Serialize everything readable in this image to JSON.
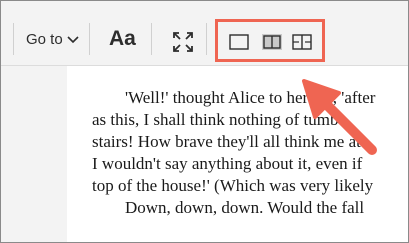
{
  "toolbar": {
    "goto_label": "Go to",
    "font_label": "Aa",
    "icons": {
      "goto_chevron": "chevron-down-icon",
      "fullscreen": "fullscreen-icon",
      "layout_single": "single-page-layout-icon",
      "layout_two": "two-page-layout-icon",
      "layout_scroll": "scrolled-layout-icon"
    },
    "selected_layout": "two-page"
  },
  "book": {
    "lines": [
      "'Well!' thought Alice to herself, 'after",
      "as this, I shall think nothing of tumb",
      "stairs! How brave they'll all think me at",
      "I wouldn't say anything about it, even if",
      "top of the house!' (Which was very likely",
      "Down, down, down. Would the fall"
    ]
  },
  "annotation": {
    "highlight_color": "#ef6552",
    "arrow_color": "#ef6552"
  }
}
